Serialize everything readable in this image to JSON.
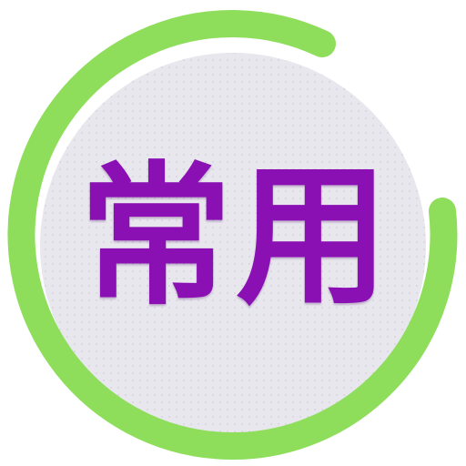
{
  "icon": {
    "label": "常用",
    "label_color": "#8a10b4",
    "ring_color": "#8ede5c",
    "disc_color": "#e9e7ee",
    "dot_color": "#cfc9d8",
    "ring_icon_name": "progress-ring-icon"
  }
}
